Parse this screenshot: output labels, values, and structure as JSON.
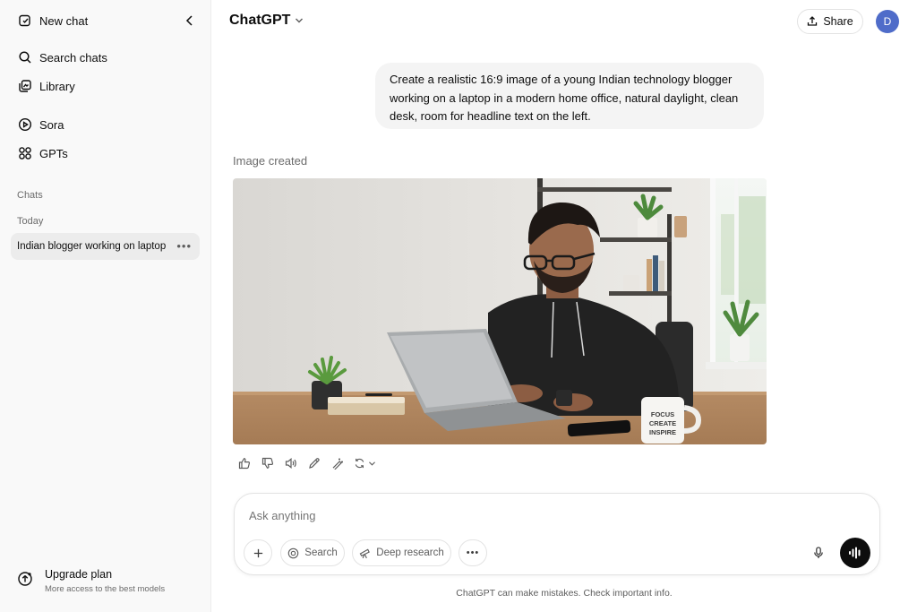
{
  "sidebar": {
    "new_chat": "New chat",
    "search_chats": "Search chats",
    "library": "Library",
    "sora": "Sora",
    "gpts": "GPTs",
    "section_chats": "Chats",
    "section_today": "Today",
    "chat_items": [
      {
        "title": "Indian blogger working on laptop"
      }
    ],
    "upgrade_title": "Upgrade plan",
    "upgrade_subtitle": "More access to the best models"
  },
  "header": {
    "model": "ChatGPT",
    "share": "Share",
    "avatar_initial": "D",
    "avatar_color": "#4f6cc9"
  },
  "conversation": {
    "user_message": "Create a realistic 16:9 image of a young Indian technology blogger working on a laptop in a modern home office, natural daylight, clean desk, room for headline text on the left.",
    "image_caption": "Image created",
    "mug_text": [
      "FOCUS",
      "CREATE",
      "INSPIRE"
    ]
  },
  "actions": [
    "thumbs-up-icon",
    "thumbs-down-icon",
    "speaker-icon",
    "edit-icon",
    "edit-image-icon",
    "regenerate-icon"
  ],
  "composer": {
    "placeholder": "Ask anything",
    "search": "Search",
    "deep_research": "Deep research"
  },
  "footer_note": "ChatGPT can make mistakes. Check important info."
}
